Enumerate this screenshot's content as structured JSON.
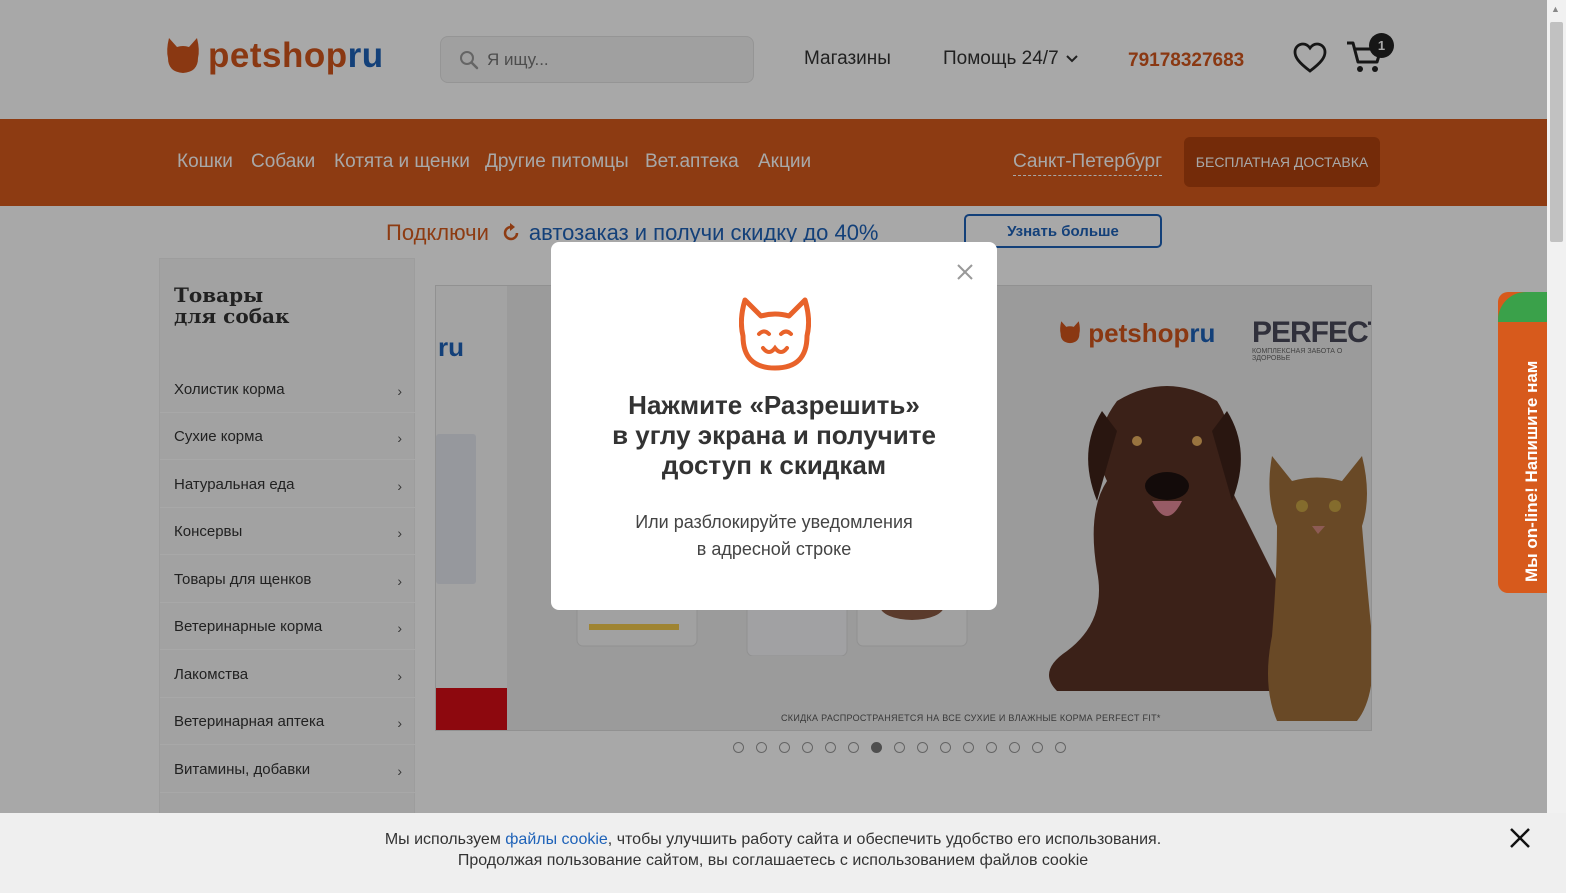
{
  "header": {
    "logo_main": "petshop",
    "logo_ru": "ru",
    "search_placeholder": "Я ищу...",
    "stores": "Магазины",
    "help": "Помощь 24/7",
    "phone": "79178327683",
    "cart_count": "1"
  },
  "catbar": {
    "items": [
      "Кошки",
      "Собаки",
      "Котята и щенки",
      "Другие питомцы",
      "Вет.аптека",
      "Акции"
    ],
    "city": "Санкт-Петербург",
    "delivery": "БЕСПЛАТНАЯ ДОСТАВКА"
  },
  "promo": {
    "text_start": "Подключи",
    "text_end": "автозаказ и получи скидку до 40%",
    "button": "Узнать больше"
  },
  "sidebar": {
    "title_line1": "Товары",
    "title_line2": "для собак",
    "items": [
      "Холистик корма",
      "Сухие корма",
      "Натуральная еда",
      "Консервы",
      "Товары для щенков",
      "Ветеринарные корма",
      "Лакомства",
      "Ветеринарная аптека",
      "Витамины, добавки"
    ]
  },
  "banner": {
    "logo_main": "petshop",
    "logo_ru": "ru",
    "left_ru": "ru",
    "perfect": "PERFECT",
    "perfect_sub": "КОМПЛЕКСНАЯ ЗАБОТА О ЗДОРОВЬЕ",
    "footnote": "СКИДКА РАСПРОСТРАНЯЕТСЯ НА ВСЕ СУХИЕ И ВЛАЖНЫЕ КОРМА PERFECT FIT*",
    "slide_count": 15,
    "active_slide": 7
  },
  "modal": {
    "title_l1": "Нажмите «Разрешить»",
    "title_l2": "в углу экрана и получите",
    "title_l3": "доступ к скидкам",
    "sub_l1": "Или разблокируйте уведомления",
    "sub_l2": "в адресной строке"
  },
  "chat": {
    "label": "Мы on-line! Напишите нам"
  },
  "cookie": {
    "text_before": "Мы используем ",
    "link": "файлы cookie",
    "text_after": ", чтобы улучшить работу сайта и обеспечить удобство его использования.",
    "line2": "Продолжая пользование сайтом, вы соглашаетесь с использованием файлов cookie"
  },
  "colors": {
    "brand_orange": "#d75a1c",
    "brand_blue": "#1e62b8",
    "delivery_bg": "#b0420e"
  }
}
